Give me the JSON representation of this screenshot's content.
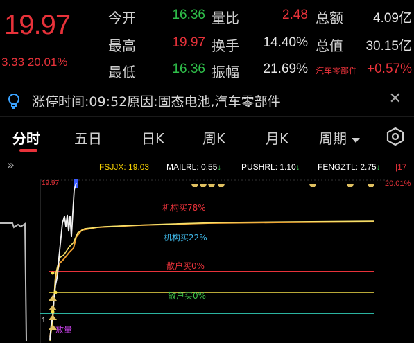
{
  "quote": {
    "price": "19.97",
    "change": "3.33",
    "change_pct": "20.01%",
    "stats": [
      {
        "label": "今开",
        "value": "16.36",
        "color": "green"
      },
      {
        "label": "量比",
        "value": "2.48",
        "color": "red"
      },
      {
        "label": "总额",
        "value": "4.09亿",
        "color": "white"
      },
      {
        "label": "最高",
        "value": "19.97",
        "color": "red"
      },
      {
        "label": "换手",
        "value": "14.40%",
        "color": "white"
      },
      {
        "label": "总值",
        "value": "30.15亿",
        "color": "white"
      },
      {
        "label": "最低",
        "value": "16.36",
        "color": "green"
      },
      {
        "label": "振幅",
        "value": "21.69%",
        "color": "white"
      },
      {
        "label": "汽车零部件",
        "value": "+0.57%",
        "color": "red"
      }
    ]
  },
  "reason_bar": {
    "text": "涨停时间:09:52原因:固态电池,汽车零部件",
    "close_glyph": "✕"
  },
  "tabs": [
    {
      "label": "分时",
      "active": true
    },
    {
      "label": "五日"
    },
    {
      "label": "日K"
    },
    {
      "label": "周K"
    },
    {
      "label": "月K"
    },
    {
      "label": "周期"
    }
  ],
  "indicators": {
    "expand_glyph": "»",
    "items": [
      {
        "name": "FSJJX",
        "value": "19.03",
        "color": "#f5d000"
      },
      {
        "name": "MAILRL",
        "value": "0.55",
        "arrow": "↓"
      },
      {
        "name": "PUSHRL",
        "value": "1.10",
        "arrow": "↓"
      },
      {
        "name": "FENGZTL",
        "value": "2.75",
        "arrow": "↓"
      }
    ],
    "overflow": "17"
  },
  "chart": {
    "price_label": "19.97",
    "pct_label": "20.01%",
    "labels": [
      {
        "text": "机构买78%",
        "color": "#e8323a"
      },
      {
        "text": "机构买22%",
        "color": "#3fb8e8"
      },
      {
        "text": "散户买0%",
        "color": "#e8323a"
      },
      {
        "text": "散户买0%",
        "color": "#3fc04a"
      }
    ],
    "bottom_label": "放量",
    "bottom_left": "1"
  }
}
